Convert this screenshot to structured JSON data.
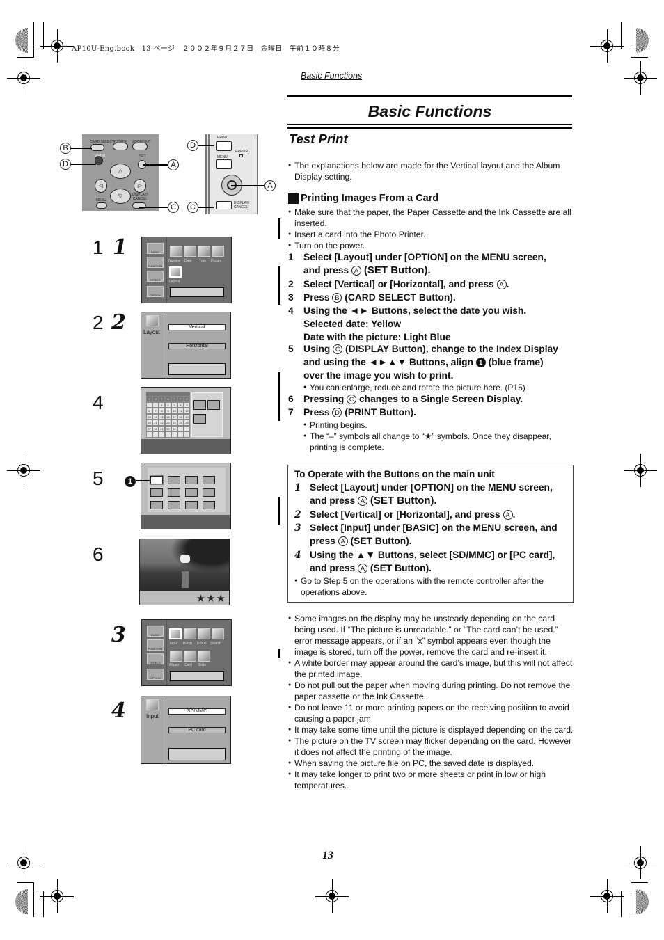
{
  "print_header": "AP10U-Eng.book　13 ページ　２００２年９月２７日　金曜日　午前１０時８分",
  "running_head": "Basic Functions",
  "title": "Basic Functions",
  "subtitle": "Test Print",
  "intro_bullet": "The explanations below are made for the Vertical layout and the Album Display setting.",
  "section_heading": "Printing Images From a Card",
  "prep_bullets": [
    "Make sure that the paper, the Paper Cassette and the Ink Cassette are all inserted.",
    "Insert a card into the Photo Printer.",
    "Turn on the power."
  ],
  "steps": [
    {
      "num": "1",
      "lines": [
        "Select [Layout] under [OPTION] on the MENU screen,",
        "and press",
        "(SET Button)."
      ],
      "circle": "A"
    },
    {
      "num": "2",
      "text_before": "Select [Vertical] or [Horizontal], and press",
      "circle": "A",
      "text_after": "."
    },
    {
      "num": "3",
      "text_before": "Press",
      "circle": "B",
      "text_after": "(CARD SELECT Button)."
    },
    {
      "num": "4",
      "lines": [
        "Using the ◄► Buttons, select the date you wish.",
        "Selected date: Yellow",
        "Date with the picture: Light Blue"
      ]
    },
    {
      "num": "5",
      "line1_before": "Using",
      "circle": "C",
      "line1_after": "(DISPLAY Button), change to the Index Display",
      "line2": "and using the ◄►▲▼ Buttons, align",
      "marker": "1",
      "line2_after": "(blue frame)",
      "line3": "over the image you wish to print.",
      "sub_bullet": "You can enlarge, reduce and rotate the picture here. (P15)"
    },
    {
      "num": "6",
      "text_before": "Pressing",
      "circle": "C",
      "text_after": "changes to a Single Screen Display."
    },
    {
      "num": "7",
      "text_before": "Press",
      "circle": "D",
      "text_after": "(PRINT Button).",
      "sub_bullets": [
        "Printing begins.",
        "The “–” symbols all change to “★” symbols. Once they disappear, printing is complete."
      ]
    }
  ],
  "main_unit_box": {
    "heading": "To Operate with the Buttons on the main unit",
    "steps": [
      {
        "num": "1",
        "line1": "Select [Layout] under [OPTION] on the MENU screen,",
        "line2_before": "and press",
        "circle": "A",
        "line2_after": "(SET Button)."
      },
      {
        "num": "2",
        "text_before": "Select [Vertical] or [Horizontal], and press",
        "circle": "A",
        "text_after": "."
      },
      {
        "num": "3",
        "line1": "Select [Input] under [BASIC] on the MENU screen, and",
        "line2_before": "press",
        "circle": "A",
        "line2_after": "(SET Button)."
      },
      {
        "num": "4",
        "line1": "Using the ▲▼ Buttons, select [SD/MMC] or [PC card],",
        "line2_before": "and press",
        "circle": "A",
        "line2_after": "(SET Button)."
      }
    ],
    "note": "Go to Step 5 on the operations with the remote controller after the operations above."
  },
  "notes": [
    "Some images on the display may be unsteady depending on the card being used. If “The picture is unreadable.” or “The card can’t be used.” error message appears, or if an “x” symbol appears even though the image is stored, turn off the power, remove the card and re-insert it.",
    "A white border may appear around the card’s image, but this will not affect the printed image.",
    "Do not pull out the paper when moving during printing. Do not remove the paper cassette or the Ink Cassette.",
    "Do not leave 11 or more printing papers on the receiving position to avoid causing a paper jam.",
    "It may take some time until the picture is displayed depending on the card.",
    "The picture on the TV screen may flicker depending on the card. However it does not affect the printing of the image.",
    "When saving the picture file on PC, the saved date is displayed.",
    "It may take longer to print two or more sheets or print in low or high temperatures."
  ],
  "page_number": "13",
  "remote": {
    "buttons": [
      "CARD SELECT",
      "ROTATE",
      "ZOOM OUT",
      "PRINT",
      "SET",
      "MENU",
      "DISPLAY/ CANCEL"
    ],
    "labels": {
      "B": "B",
      "D": "D",
      "A": "A",
      "C": "C"
    }
  },
  "main_unit": {
    "buttons": [
      "PRINT",
      "MENU",
      "DISPLAY/ CANCEL"
    ],
    "indicator": "ERROR",
    "labels": {
      "D": "D",
      "A": "A",
      "C": "C"
    }
  },
  "left_step_numbers": {
    "remote": [
      "1",
      "2",
      "4",
      "5",
      "6"
    ],
    "unit": [
      "1",
      "2",
      "3",
      "4"
    ]
  },
  "screens": {
    "menu_tabs": [
      "BASIC",
      "FUNCTION",
      "EFFECT",
      "OPTION"
    ],
    "option_items": [
      "Number",
      "Date",
      "Trim",
      "Picture",
      "Layout"
    ],
    "layout_title": "Layout",
    "layout_options": [
      "Vertical",
      "Horizontal"
    ],
    "calendar_headers": [
      "S",
      "M",
      "T",
      "W",
      "T",
      "F",
      "S"
    ],
    "calendar_days": [
      "",
      "",
      "1",
      "2",
      "3",
      "4",
      "5",
      "6",
      "7",
      "8",
      "9",
      "10",
      "11",
      "12",
      "13",
      "14",
      "15",
      "16",
      "17",
      "18",
      "19",
      "20",
      "21",
      "22",
      "23",
      "24",
      "25",
      "26",
      "27",
      "28",
      "29",
      "30",
      "31",
      "",
      "",
      "",
      "",
      "",
      "",
      "",
      "",
      ""
    ],
    "single_display_stars": "★★★",
    "basic_items": [
      "Input",
      "Batch",
      "DPOF",
      "Search",
      "Album",
      "Card",
      "Slide"
    ],
    "input_title": "Input",
    "input_options": [
      "SD/MMC",
      "PC card"
    ],
    "marker": "1"
  }
}
